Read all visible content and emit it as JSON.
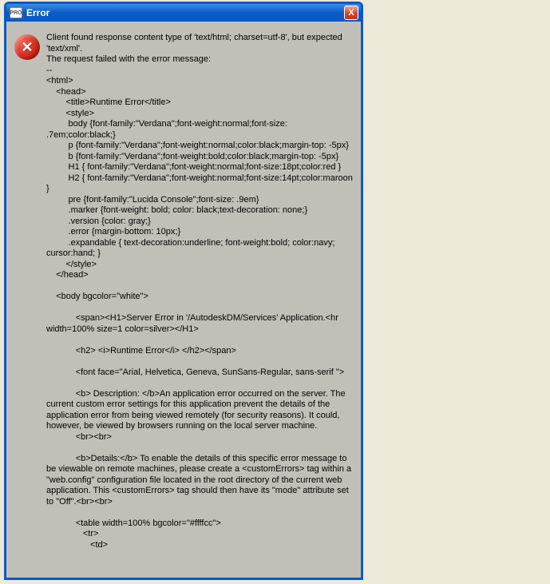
{
  "window": {
    "badge": "PRO",
    "title": "Error"
  },
  "icons": {
    "close_glyph": "X",
    "error_glyph": "✕"
  },
  "message": {
    "intro": "Client found response content type of 'text/html; charset=utf-8', but expected 'text/xml'.\nThe request failed with the error message:\n--\n<html>\n    <head>\n        <title>Runtime Error</title>\n        <style>\n         body {font-family:\"Verdana\";font-weight:normal;font-size: .7em;color:black;}\n         p {font-family:\"Verdana\";font-weight:normal;color:black;margin-top: -5px}\n         b {font-family:\"Verdana\";font-weight:bold;color:black;margin-top: -5px}\n         H1 { font-family:\"Verdana\";font-weight:normal;font-size:18pt;color:red }\n         H2 { font-family:\"Verdana\";font-weight:normal;font-size:14pt;color:maroon }\n         pre {font-family:\"Lucida Console\";font-size: .9em}\n         .marker {font-weight: bold; color: black;text-decoration: none;}\n         .version {color: gray;}\n         .error {margin-bottom: 10px;}\n         .expandable { text-decoration:underline; font-weight:bold; color:navy; cursor:hand; }\n        </style>\n    </head>\n\n    <body bgcolor=\"white\">\n\n            <span><H1>Server Error in '/AutodeskDM/Services' Application.<hr width=100% size=1 color=silver></H1>\n\n            <h2> <i>Runtime Error</i> </h2></span>\n\n            <font face=\"Arial, Helvetica, Geneva, SunSans-Regular, sans-serif \">\n\n            <b> Description: </b>An application error occurred on the server. The current custom error settings for this application prevent the details of the application error from being viewed remotely (for security reasons). It could, however, be viewed by browsers running on the local server machine.\n            <br><br>\n\n            <b>Details:</b> To enable the details of this specific error message to be viewable on remote machines, please create a <customErrors> tag within a \"web.config\" configuration file located in the root directory of the current web application. This <customErrors> tag should then have its \"mode\" attribute set to \"Off\".<br><br>\n\n            <table width=100% bgcolor=\"#ffffcc\">\n               <tr>\n                  <td>"
  }
}
